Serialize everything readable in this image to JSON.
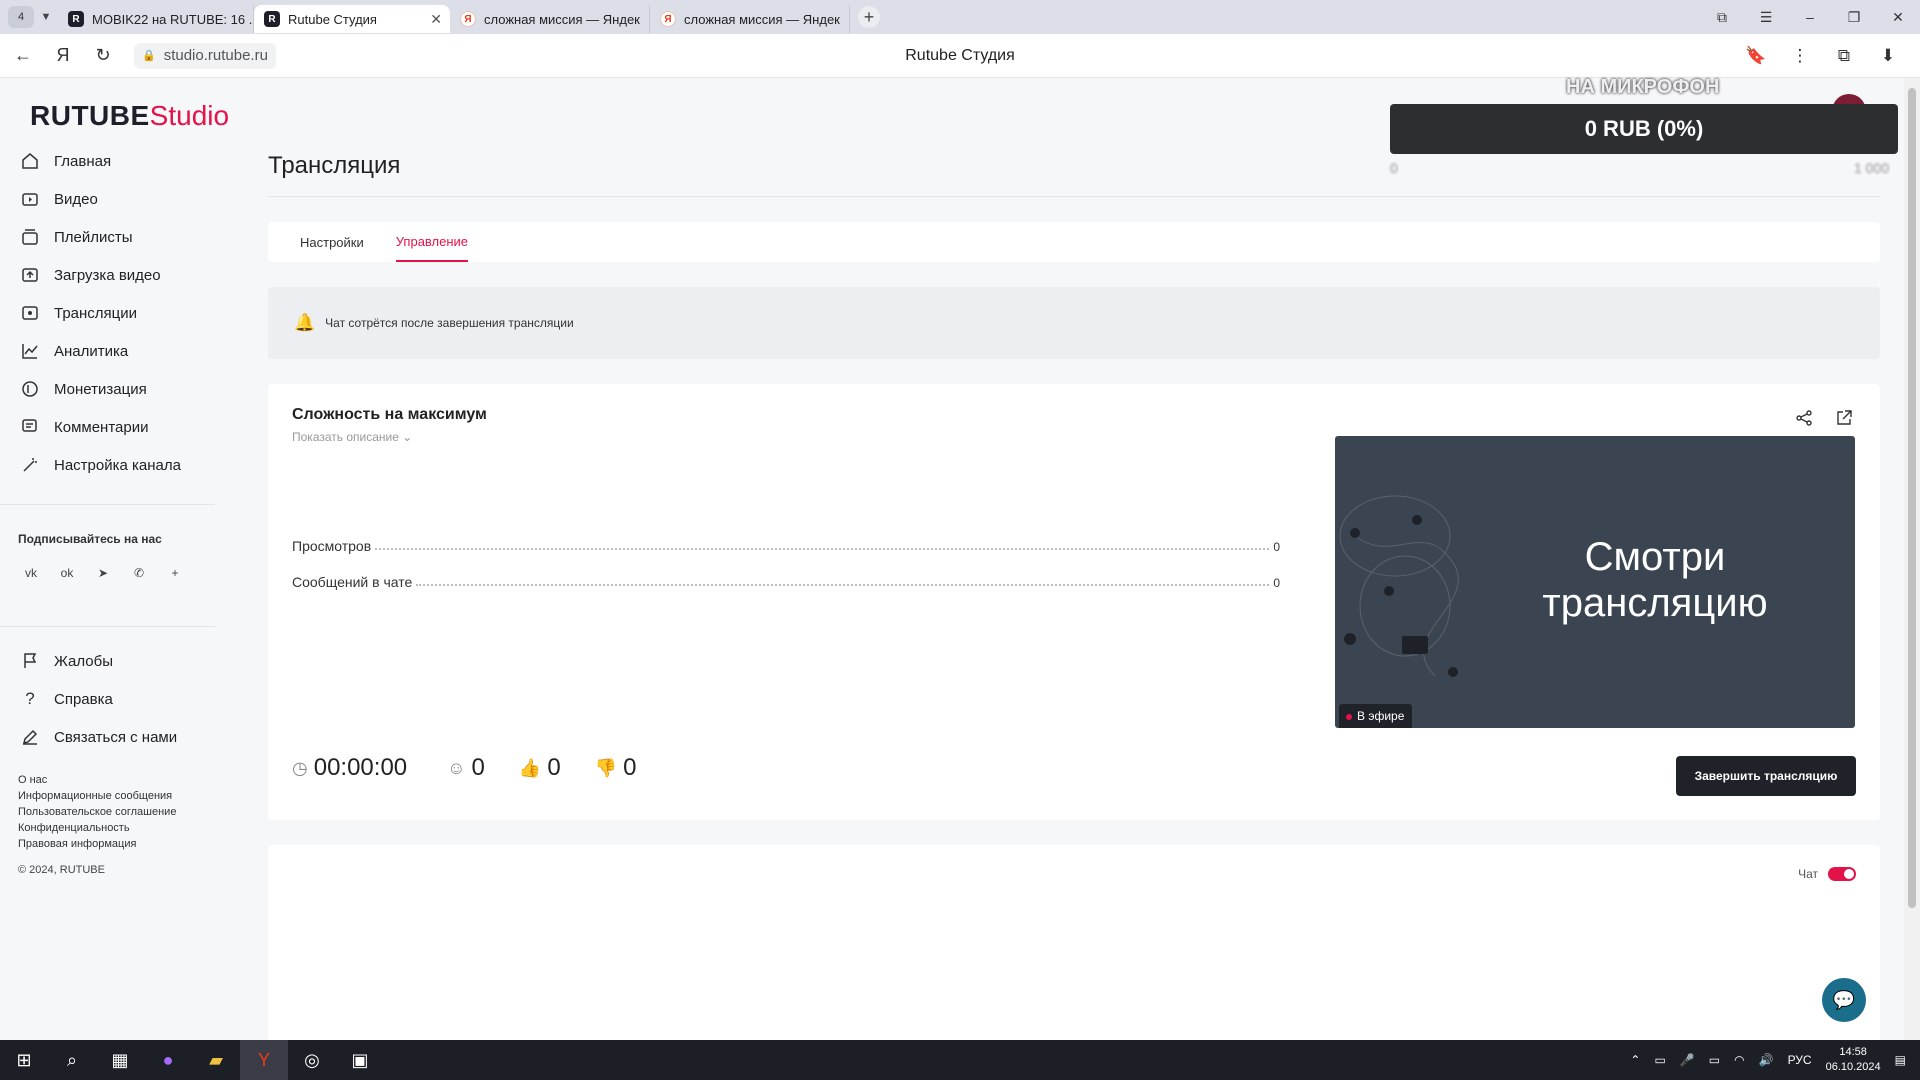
{
  "browser": {
    "tab_count": "4",
    "tabs": [
      {
        "label": "MOBIK22 на RUTUBE: 16 ...",
        "favicon": "R"
      },
      {
        "label": "Rutube Студия",
        "favicon": "R"
      },
      {
        "label": "сложная миссия — Яндек",
        "favicon": "Я"
      },
      {
        "label": "сложная миссия — Яндек",
        "favicon": "Я"
      }
    ],
    "url": "studio.rutube.ru",
    "page_title": "Rutube Студия"
  },
  "sidebar": {
    "logo_main": "RUTUBE",
    "logo_suffix": "Studio",
    "items": [
      {
        "label": "Главная",
        "icon": "home-icon"
      },
      {
        "label": "Видео",
        "icon": "video-icon"
      },
      {
        "label": "Плейлисты",
        "icon": "playlist-icon"
      },
      {
        "label": "Загрузка видео",
        "icon": "upload-icon"
      },
      {
        "label": "Трансляции",
        "icon": "broadcast-icon"
      },
      {
        "label": "Аналитика",
        "icon": "analytics-icon"
      },
      {
        "label": "Монетизация",
        "icon": "monetization-icon"
      },
      {
        "label": "Комментарии",
        "icon": "comments-icon"
      },
      {
        "label": "Настройка канала",
        "icon": "settings-wand-icon"
      }
    ],
    "follow_title": "Подписывайтесь на нас",
    "socials": [
      "vk-icon",
      "ok-icon",
      "telegram-icon",
      "viber-icon",
      "more-icon"
    ],
    "items2": [
      {
        "label": "Жалобы",
        "icon": "flag-icon"
      },
      {
        "label": "Справка",
        "icon": "help-icon"
      },
      {
        "label": "Связаться с нами",
        "icon": "pen-icon"
      }
    ],
    "footer_links": [
      "О нас",
      "Информационные сообщения",
      "Пользовательское соглашение",
      "Конфиденциальность",
      "Правовая информация"
    ],
    "copyright": "© 2024, RUTUBE"
  },
  "main": {
    "title": "Трансляция",
    "tabs": [
      {
        "label": "Настройки",
        "active": false
      },
      {
        "label": "Управление",
        "active": true
      }
    ],
    "notice": "Чат сотрётся после завершения трансляции",
    "stream": {
      "title": "Сложность на максимум",
      "show_description": "Показать описание",
      "stats": [
        {
          "label": "Просмотров",
          "value": "0"
        },
        {
          "label": "Сообщений в чате",
          "value": "0"
        }
      ],
      "preview_text_line1": "Смотри",
      "preview_text_line2": "трансляцию",
      "live_badge": "В эфире",
      "duration": "00:00:00",
      "viewers": "0",
      "likes": "0",
      "dislikes": "0",
      "end_button": "Завершить трансляцию"
    },
    "chat_label": "Чат",
    "chat_enabled": true
  },
  "overlay": {
    "top_text": "НА МИКРОФОН",
    "amount": "0 RUB (0%)",
    "min": "0",
    "max": "1 000",
    "progress_fraction": 0
  },
  "taskbar": {
    "language": "РУС",
    "time": "14:58",
    "date": "06.10.2024"
  },
  "colors": {
    "accent": "#e3134a",
    "dark_button": "#1f2329"
  }
}
